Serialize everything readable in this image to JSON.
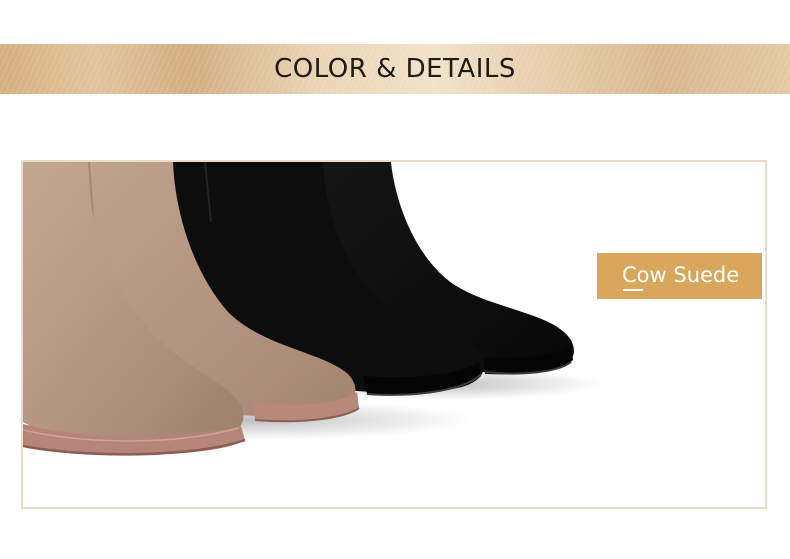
{
  "banner": {
    "title": "COLOR & DETAILS"
  },
  "material_tag": {
    "label": "Cow Suede"
  },
  "photo": {
    "subject": "suede-boots-photo",
    "colors": {
      "taupe_suede": "#b59883",
      "black_suede": "#0f0f0f",
      "sole_tan": "#b07d6f",
      "accent_tag": "#d9a75b"
    }
  }
}
